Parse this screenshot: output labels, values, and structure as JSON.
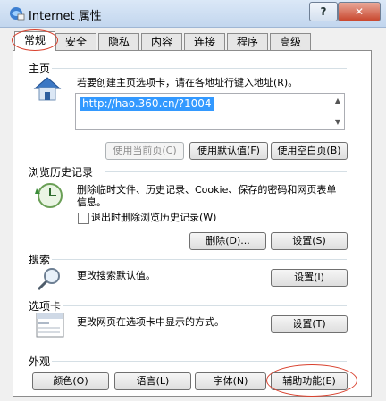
{
  "window": {
    "title": "Internet 属性",
    "help_label": "?",
    "close_label": "✕"
  },
  "tabs": [
    {
      "label": "常规"
    },
    {
      "label": "安全"
    },
    {
      "label": "隐私"
    },
    {
      "label": "内容"
    },
    {
      "label": "连接"
    },
    {
      "label": "程序"
    },
    {
      "label": "高级"
    }
  ],
  "homepage": {
    "title": "主页",
    "hint": "若要创建主页选项卡，请在各地址行键入地址(R)。",
    "url": "http://hao.360.cn/?1004",
    "btn_current": "使用当前页(C)",
    "btn_default": "使用默认值(F)",
    "btn_blank": "使用空白页(B)"
  },
  "history": {
    "title": "浏览历史记录",
    "desc": "删除临时文件、历史记录、Cookie、保存的密码和网页表单信息。",
    "checkbox_label": "退出时删除浏览历史记录(W)",
    "btn_delete": "删除(D)...",
    "btn_settings": "设置(S)"
  },
  "search": {
    "title": "搜索",
    "desc": "更改搜索默认值。",
    "btn_settings": "设置(I)"
  },
  "tabs_section": {
    "title": "选项卡",
    "desc": "更改网页在选项卡中显示的方式。",
    "btn_settings": "设置(T)"
  },
  "appearance": {
    "title": "外观",
    "btn_colors": "颜色(O)",
    "btn_languages": "语言(L)",
    "btn_fonts": "字体(N)",
    "btn_accessibility": "辅助功能(E)"
  },
  "colors": {
    "highlight": "#d9412e",
    "selection": "#3399ff",
    "panel": "#ffffff"
  },
  "icons": [
    "internet-options-icon",
    "house-icon",
    "clock-icon",
    "magnifier-icon",
    "tabs-window-icon"
  ]
}
